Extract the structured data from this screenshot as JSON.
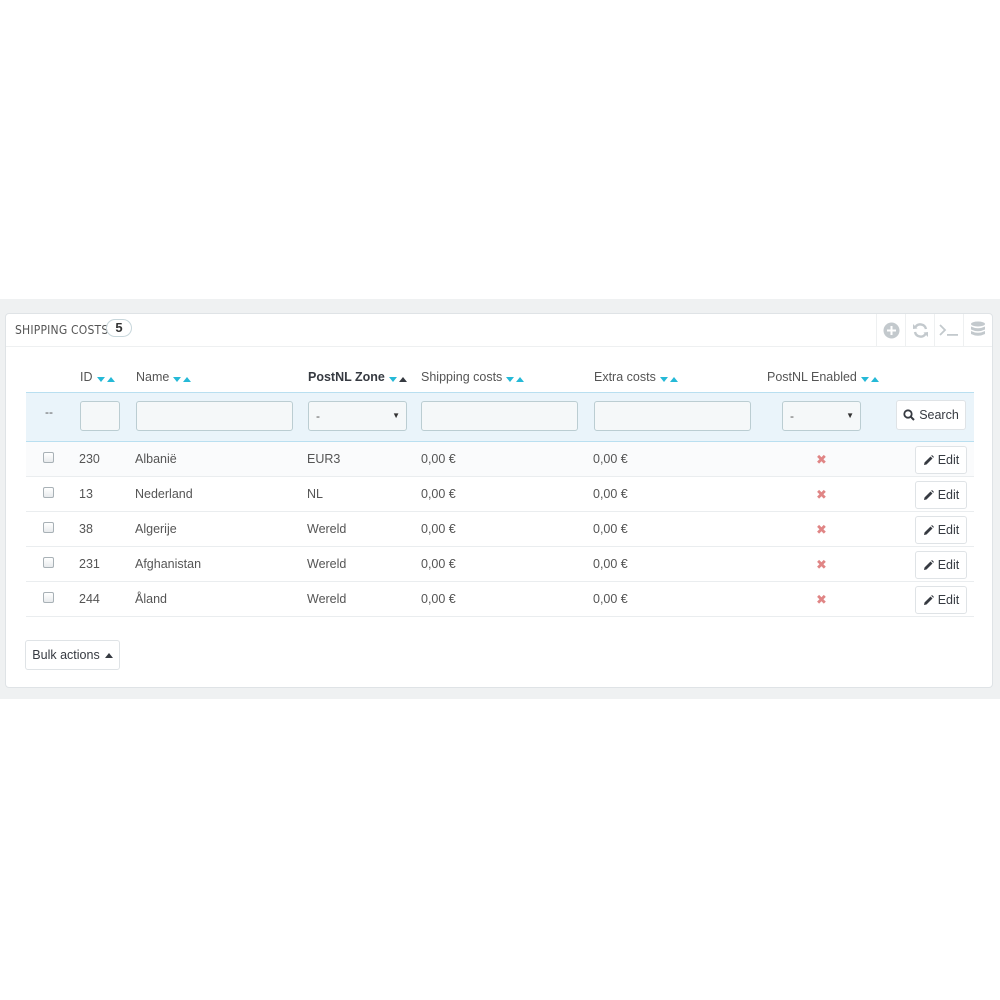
{
  "panel": {
    "title": "SHIPPING COSTS",
    "count": "5",
    "toolbar": [
      {
        "icon": "add-circle-icon"
      },
      {
        "icon": "refresh-icon"
      },
      {
        "icon": "sql-terminal-icon"
      },
      {
        "icon": "database-icon"
      }
    ]
  },
  "columns": {
    "id": "ID",
    "name": "Name",
    "zone": "PostNL Zone",
    "shipping": "Shipping costs",
    "extra": "Extra costs",
    "enabled": "PostNL Enabled"
  },
  "sorted_column": "zone",
  "filters": {
    "dash": "--",
    "zone_select": "-",
    "enabled_select": "-",
    "search_label": "Search"
  },
  "rows": [
    {
      "id": "230",
      "name": "Albanië",
      "zone": "EUR3",
      "shipping": "0,00 €",
      "extra": "0,00 €",
      "enabled": false
    },
    {
      "id": "13",
      "name": "Nederland",
      "zone": "NL",
      "shipping": "0,00 €",
      "extra": "0,00 €",
      "enabled": false
    },
    {
      "id": "38",
      "name": "Algerije",
      "zone": "Wereld",
      "shipping": "0,00 €",
      "extra": "0,00 €",
      "enabled": false
    },
    {
      "id": "231",
      "name": "Afghanistan",
      "zone": "Wereld",
      "shipping": "0,00 €",
      "extra": "0,00 €",
      "enabled": false
    },
    {
      "id": "244",
      "name": "Åland",
      "zone": "Wereld",
      "shipping": "0,00 €",
      "extra": "0,00 €",
      "enabled": false
    }
  ],
  "edit_label": "Edit",
  "bulk_actions_label": "Bulk actions",
  "colors": {
    "accent": "#25b9d7",
    "disabled_x": "#e08585",
    "filter_bg": "#eaf4fa"
  }
}
